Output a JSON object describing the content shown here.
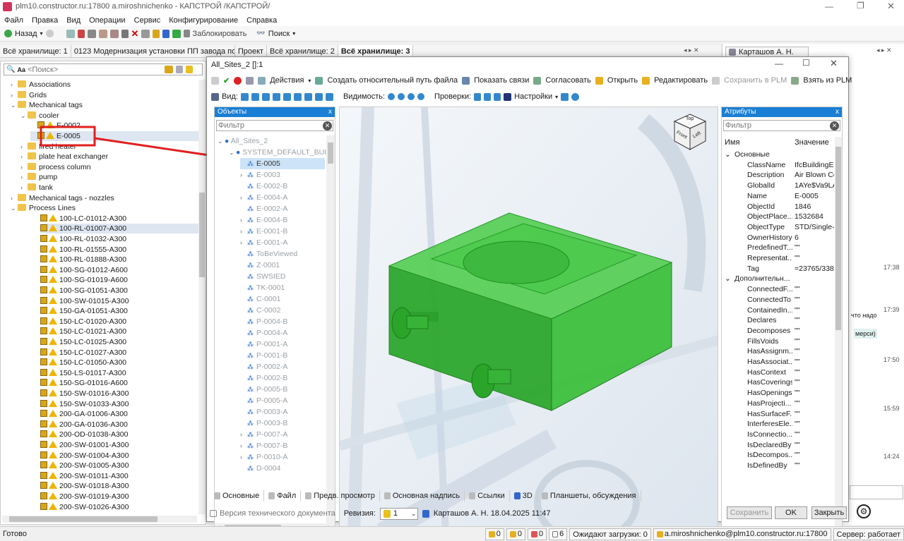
{
  "window": {
    "title": "plm10.constructor.ru:17800 a.miroshnichenko - КАПСТРОЙ /КАПСТРОЙ/"
  },
  "menu": [
    "Файл",
    "Правка",
    "Вид",
    "Операции",
    "Сервис",
    "Конфигурирование",
    "Справка"
  ],
  "toolbar": {
    "back": "Назад",
    "lock": "Заблокировать",
    "search": "Поиск"
  },
  "tabs": [
    "Всё хранилище: 1",
    "0123 Модернизация установки ПП завода по...",
    "Проект",
    "Всё хранилище: 2",
    "Всё хранилище: 3"
  ],
  "left": {
    "search_placeholder": "<Поиск>",
    "tree": [
      {
        "label": "Associations",
        "type": "folder",
        "indent": 0
      },
      {
        "label": "Grids",
        "type": "folder",
        "indent": 0
      },
      {
        "label": "Mechanical tags",
        "type": "folder",
        "indent": 0,
        "open": true
      },
      {
        "label": "cooler",
        "type": "folder",
        "indent": 1,
        "open": true
      },
      {
        "label": "E-0002",
        "type": "tag",
        "indent": 2
      },
      {
        "label": "E-0005",
        "type": "tag",
        "indent": 2
      },
      {
        "label": "fired heater",
        "type": "folder",
        "indent": 1
      },
      {
        "label": "plate heat exchanger",
        "type": "folder",
        "indent": 1
      },
      {
        "label": "process column",
        "type": "folder",
        "indent": 1
      },
      {
        "label": "pump",
        "type": "folder",
        "indent": 1
      },
      {
        "label": "tank",
        "type": "folder",
        "indent": 1
      },
      {
        "label": "Mechanical tags - nozzles",
        "type": "folder",
        "indent": 0
      },
      {
        "label": "Process Lines",
        "type": "folder",
        "indent": 0,
        "open": true
      }
    ],
    "lines": [
      "100-LC-01012-A300",
      "100-RL-01007-A300",
      "100-RL-01032-A300",
      "100-RL-01555-A300",
      "100-RL-01888-A300",
      "100-SG-01012-A600",
      "100-SG-01019-A600",
      "100-SG-01051-A300",
      "100-SW-01015-A300",
      "150-GA-01051-A300",
      "150-LC-01020-A300",
      "150-LC-01021-A300",
      "150-LC-01025-A300",
      "150-LC-01027-A300",
      "150-LC-01050-A300",
      "150-LS-01017-A300",
      "150-SG-01016-A600",
      "150-SW-01016-A300",
      "150-SW-01033-A300",
      "200-GA-01006-A300",
      "200-GA-01036-A300",
      "200-OD-01038-A300",
      "200-SW-01001-A300",
      "200-SW-01004-A300",
      "200-SW-01005-A300",
      "200-SW-01011-A300",
      "200-SW-01018-A300",
      "200-SW-01019-A300",
      "200-SW-01026-A300"
    ],
    "highlight": "E-0005"
  },
  "dialog": {
    "title": "All_Sites_2 []:1",
    "toolbar": {
      "actions": "Действия",
      "rel_path": "Создать относительный путь файла",
      "links": "Показать связи",
      "approve": "Согласовать",
      "open": "Открыть",
      "edit": "Редактировать",
      "save_plm": "Сохранить в PLM",
      "take_plm": "Взять из PLM"
    },
    "toolbar2": {
      "view": "Вид:",
      "visibility": "Видимость:",
      "checks": "Проверки:",
      "settings": "Настройки"
    },
    "objects": {
      "header": "Объекты",
      "filter": "Фильтр",
      "root": "All_Sites_2",
      "site": "SYSTEM_DEFAULT_BUILD",
      "items": [
        "E-0005",
        "E-0003",
        "E-0002-B",
        "E-0004-A",
        "E-0002-A",
        "E-0004-B",
        "E-0001-B",
        "E-0001-A",
        "ToBeViewed",
        "Z-0001",
        "SWSIED",
        "TK-0001",
        "C-0001",
        "C-0002",
        "P-0004-B",
        "P-0004-A",
        "P-0001-A",
        "P-0001-B",
        "P-0002-A",
        "P-0002-B",
        "P-0005-B",
        "P-0005-A",
        "P-0003-A",
        "P-0003-B",
        "P-0007-A",
        "P-0007-B",
        "P-0010-A",
        "D-0004"
      ]
    },
    "viewcube": {
      "top": "Top",
      "front": "Front",
      "left": "Left"
    },
    "attributes": {
      "header": "Атрибуты",
      "filter": "Фильтр",
      "col_name": "Имя",
      "col_value": "Значение",
      "group1": "Основные",
      "basic": [
        [
          "ClassName",
          "IfcBuildingEl"
        ],
        [
          "Description",
          "Air Blown Co"
        ],
        [
          "GlobalId",
          "1AYe$Va9LA"
        ],
        [
          "Name",
          "E-0005"
        ],
        [
          "ObjectId",
          "1846"
        ],
        [
          "ObjectPlace...",
          "1532684"
        ],
        [
          "ObjectType",
          "STD/Single-"
        ],
        [
          "OwnerHistory",
          "6"
        ],
        [
          "PredefinedT...",
          "\"\""
        ],
        [
          "Representat...",
          "\"\""
        ],
        [
          "Tag",
          "=23765/338"
        ]
      ],
      "group2": "Дополнительн...",
      "extra": [
        [
          "ConnectedF...",
          "\"\""
        ],
        [
          "ConnectedTo",
          "\"\""
        ],
        [
          "ContainedIn...",
          "\"\""
        ],
        [
          "Declares",
          "\"\""
        ],
        [
          "Decomposes",
          "\"\""
        ],
        [
          "FillsVoids",
          "\"\""
        ],
        [
          "HasAssignm...",
          "\"\""
        ],
        [
          "HasAssociat...",
          "\"\""
        ],
        [
          "HasContext",
          "\"\""
        ],
        [
          "HasCoverings",
          "\"\""
        ],
        [
          "HasOpenings",
          "\"\""
        ],
        [
          "HasProjecti...",
          "\"\""
        ],
        [
          "HasSurfaceF...",
          "\"\""
        ],
        [
          "InterferesEle...",
          "\"\""
        ],
        [
          "IsConnectio...",
          "\"\""
        ],
        [
          "IsDeclaredBy",
          "\"\""
        ],
        [
          "IsDecompos...",
          "\"\""
        ],
        [
          "IsDefinedBy",
          "\"\""
        ]
      ]
    },
    "bottom_tabs": [
      "Основные",
      "Файл",
      "Предв. просмотр",
      "Основная надпись",
      "Ссылки",
      "3D",
      "Планшеты, обсуждения"
    ],
    "footer": {
      "doc_version": "Версия технического документа",
      "revision_label": "Ревизия:",
      "revision": "1",
      "author": "Карташов А. Н. 18.04.2025 11:47",
      "save": "Сохранить",
      "ok": "OK",
      "close": "Закрыть"
    }
  },
  "right": {
    "user": "Карташов А. Н.",
    "times": [
      "17:38",
      "17:39",
      "17:50",
      "15:59",
      "14:24"
    ],
    "snippets": [
      "что надо",
      "мерси)"
    ]
  },
  "status": {
    "ready": "Готово",
    "c1": "0",
    "c2": "0",
    "c3": "0",
    "c4": "6",
    "waiting": "Ожидают загрузки: 0",
    "user": "a.miroshnichenko@plm10.constructor.ru:17800",
    "server": "Сервер: работает"
  }
}
